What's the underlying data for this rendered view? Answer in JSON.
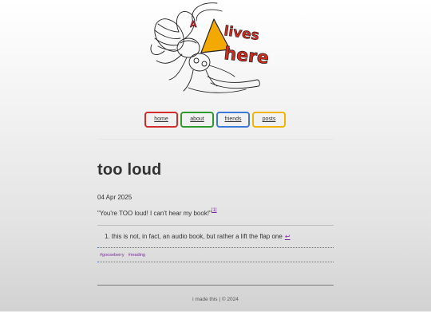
{
  "header": {
    "logo_text_line1": "lives",
    "logo_text_line2": "here",
    "logo_prefix": "A"
  },
  "nav": {
    "items": [
      {
        "label": "home",
        "color": "#d22c2c"
      },
      {
        "label": "about",
        "color": "#2c9a2c"
      },
      {
        "label": "friends",
        "color": "#3b7ad8"
      },
      {
        "label": "posts",
        "color": "#f2b400"
      }
    ]
  },
  "post": {
    "title": "too loud",
    "date": "04 Apr 2025",
    "body": "\"You're TOO loud! I can't hear my book!\"",
    "footnote_ref": "[1]",
    "footnotes": [
      {
        "number": "1.",
        "text": "this is not, in fact, an audio book, but rather a lift the flap one",
        "back_icon": "↩"
      }
    ],
    "tags": [
      "#gooseberry",
      "#reading"
    ]
  },
  "footer": {
    "text": "i made this | © 2024"
  }
}
